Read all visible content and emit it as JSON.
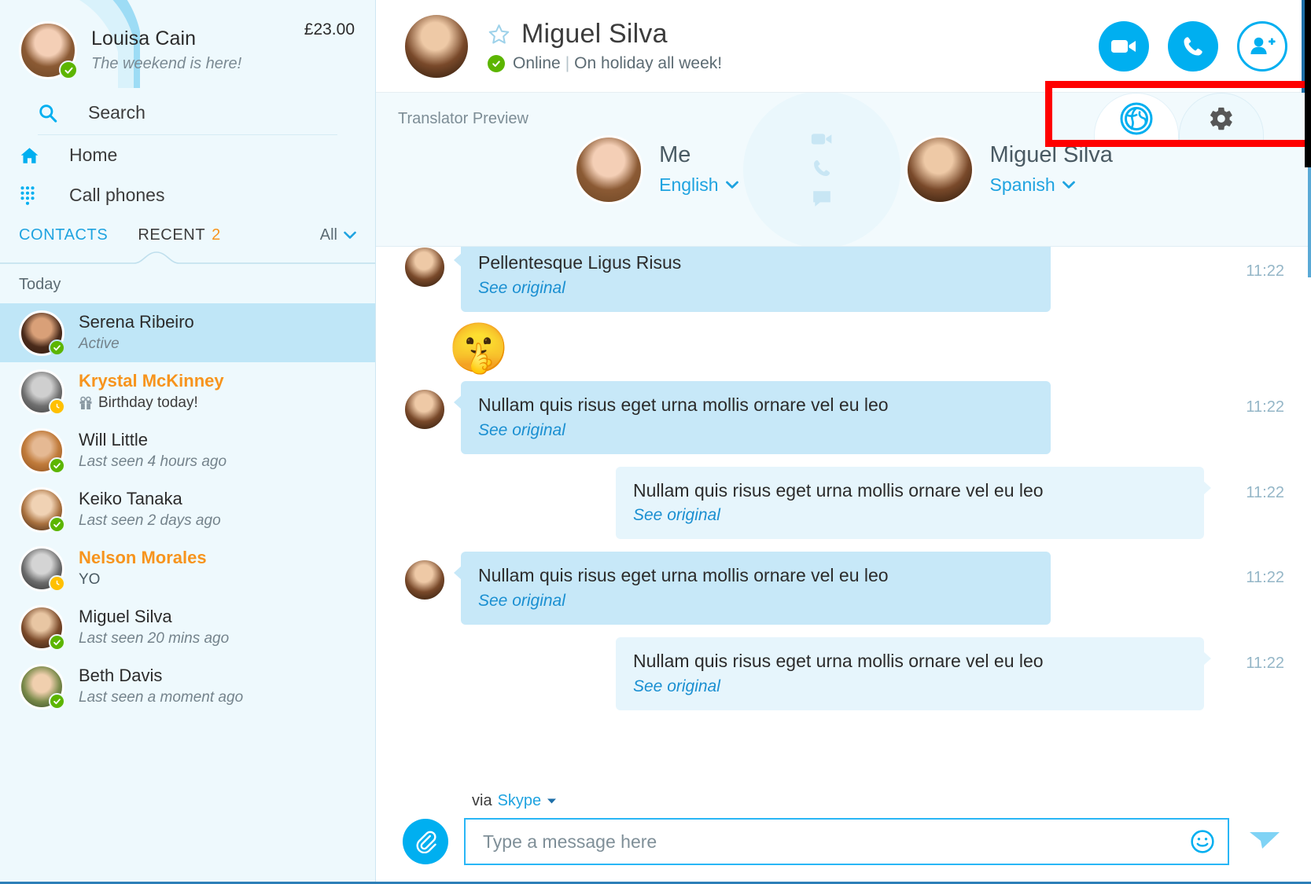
{
  "sidebar": {
    "profile": {
      "name": "Louisa Cain",
      "mood": "The weekend is here!",
      "credit": "£23.00",
      "presence": "online"
    },
    "search": {
      "label": "Search",
      "icon": "search-icon"
    },
    "nav": [
      {
        "label": "Home",
        "icon": "home-icon"
      },
      {
        "label": "Call phones",
        "icon": "dialpad-icon"
      }
    ],
    "tabs": {
      "contacts": "CONTACTS",
      "recent": "RECENT",
      "recent_badge": "2",
      "filter": "All"
    },
    "day_label": "Today",
    "contacts": [
      {
        "name": "Serena Ribeiro",
        "sub": "Active",
        "presence": "online",
        "selected": true,
        "alert": false,
        "sub_style": "italic"
      },
      {
        "name": "Krystal McKinney",
        "sub": "Birthday today!",
        "presence": "away",
        "selected": false,
        "alert": true,
        "sub_style": "gift"
      },
      {
        "name": "Will Little",
        "sub": "Last seen 4 hours ago",
        "presence": "online",
        "selected": false,
        "alert": false,
        "sub_style": "italic"
      },
      {
        "name": "Keiko Tanaka",
        "sub": "Last seen 2 days ago",
        "presence": "online",
        "selected": false,
        "alert": false,
        "sub_style": "italic"
      },
      {
        "name": "Nelson Morales",
        "sub": "YO",
        "presence": "away",
        "selected": false,
        "alert": true,
        "sub_style": "plain"
      },
      {
        "name": "Miguel Silva",
        "sub": "Last seen 20 mins ago",
        "presence": "online",
        "selected": false,
        "alert": false,
        "sub_style": "italic"
      },
      {
        "name": "Beth Davis",
        "sub": "Last seen a moment ago",
        "presence": "online",
        "selected": false,
        "alert": false,
        "sub_style": "italic"
      }
    ]
  },
  "chat_header": {
    "name": "Miguel Silva",
    "status": "Online",
    "separator": "|",
    "mood": "On holiday all week!",
    "favorite_icon": "star-icon",
    "actions": [
      {
        "name": "video-call-button",
        "icon": "video-camera-icon",
        "style": "filled"
      },
      {
        "name": "voice-call-button",
        "icon": "phone-icon",
        "style": "filled"
      },
      {
        "name": "add-people-button",
        "icon": "add-person-icon",
        "style": "outline"
      }
    ]
  },
  "translator_toolbar": {
    "tabs": [
      {
        "name": "translator-tab",
        "icon": "globe-icon",
        "active": true
      },
      {
        "name": "settings-tab",
        "icon": "gear-icon",
        "active": false
      }
    ],
    "highlight_color": "#ff0000"
  },
  "translator_panel": {
    "label": "Translator Preview",
    "me": {
      "name": "Me",
      "language": "English"
    },
    "other": {
      "name": "Miguel Silva",
      "language": "Spanish"
    },
    "middle_icons": [
      "video-camera-icon",
      "phone-icon",
      "chat-bubble-icon"
    ]
  },
  "messages": [
    {
      "dir": "incoming",
      "text": "Pellentesque Ligus Risus",
      "see_original": "See original",
      "time": "11:22",
      "clipped": true
    },
    {
      "dir": "emoji",
      "emoji": "🤫",
      "time": ""
    },
    {
      "dir": "incoming",
      "text": "Nullam quis risus eget urna mollis ornare vel eu leo",
      "see_original": "See original",
      "time": "11:22"
    },
    {
      "dir": "outgoing",
      "text": "Nullam quis risus eget urna mollis ornare vel eu leo",
      "see_original": "See original",
      "time": "11:22"
    },
    {
      "dir": "incoming",
      "text": "Nullam quis risus eget urna mollis ornare vel eu leo",
      "see_original": "See original",
      "time": "11:22"
    },
    {
      "dir": "outgoing",
      "text": "Nullam quis risus eget urna mollis ornare vel eu leo",
      "see_original": "See original",
      "time": "11:22"
    }
  ],
  "composer": {
    "via_prefix": "via",
    "via_service": "Skype",
    "placeholder": "Type a message here",
    "attach_icon": "paperclip-icon",
    "emoji_icon": "smiley-icon",
    "send_icon": "send-paper-plane-icon"
  },
  "colors": {
    "skype_blue": "#00aff0",
    "accent_orange": "#f7941d",
    "online_green": "#5cb500",
    "away_yellow": "#ffc000",
    "bubble_in": "#c7e8f8",
    "bubble_out": "#e6f5fc",
    "sidebar_bg": "#eef9fd",
    "selected_row": "#bfe6f7"
  }
}
